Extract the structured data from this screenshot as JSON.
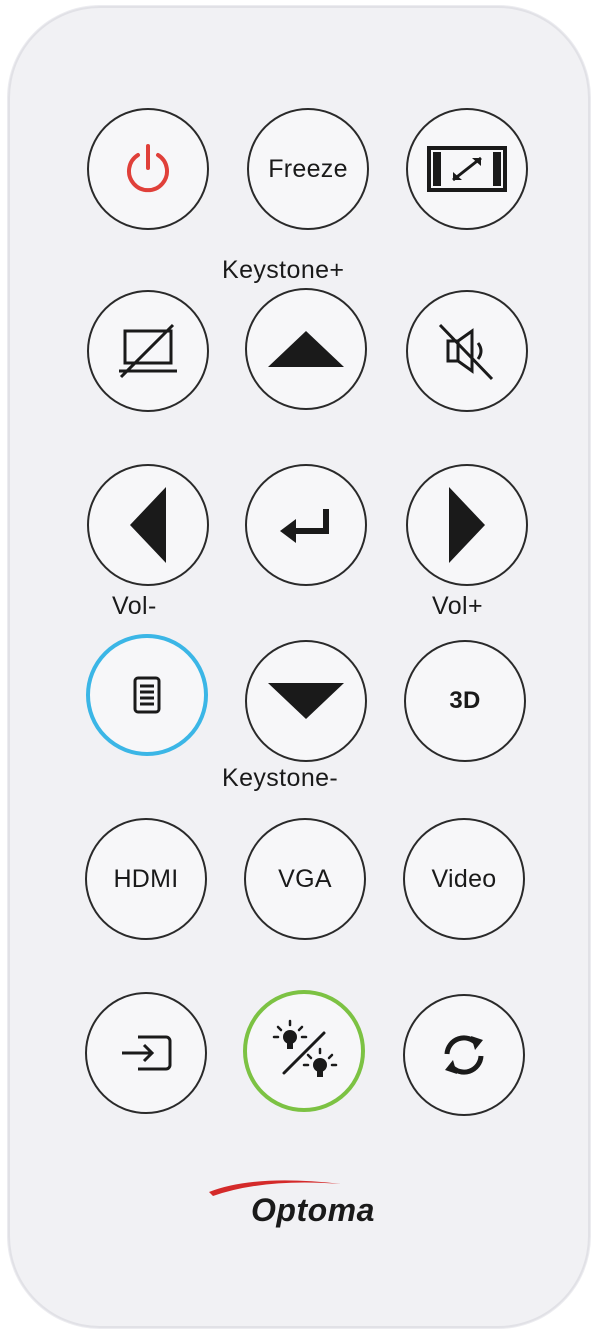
{
  "labels": {
    "keystone_plus": "Keystone+",
    "keystone_minus": "Keystone-",
    "vol_minus": "Vol-",
    "vol_plus": "Vol+"
  },
  "buttons": {
    "power": {
      "icon": "power-icon",
      "color": "#e0403a"
    },
    "freeze": {
      "label": "Freeze"
    },
    "aspect": {
      "icon": "aspect-ratio-icon"
    },
    "blank": {
      "icon": "blank-screen-icon"
    },
    "up": {
      "icon": "triangle-up-icon"
    },
    "mute": {
      "icon": "mute-speaker-icon"
    },
    "left": {
      "icon": "triangle-left-icon"
    },
    "enter": {
      "icon": "enter-return-icon"
    },
    "right": {
      "icon": "triangle-right-icon"
    },
    "menu": {
      "icon": "menu-list-icon",
      "ring_color": "#3bb6e6"
    },
    "down": {
      "icon": "triangle-down-icon"
    },
    "three_d": {
      "label": "3D"
    },
    "hdmi": {
      "label": "HDMI"
    },
    "vga": {
      "label": "VGA"
    },
    "video": {
      "label": "Video"
    },
    "source": {
      "icon": "source-input-icon"
    },
    "brightness": {
      "icon": "brightness-mode-icon",
      "ring_color": "#7cc243"
    },
    "resync": {
      "icon": "resync-arrows-icon"
    }
  },
  "brand": {
    "name": "Optoma",
    "swoosh_color": "#d42a2a"
  }
}
